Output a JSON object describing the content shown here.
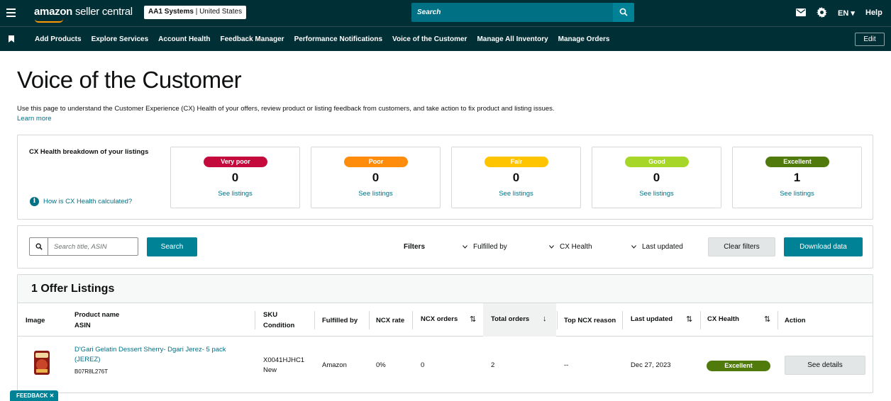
{
  "topbar": {
    "logo_text": "amazon",
    "logo_suffix": "seller central",
    "account_name": "AA1 Systems",
    "account_region": "United States",
    "search_placeholder": "Search",
    "language": "EN ▾",
    "help": "Help",
    "icons": [
      "hamburger-icon",
      "search-icon",
      "mail-icon",
      "gear-icon"
    ]
  },
  "nav": {
    "items": [
      {
        "label": "Add Products"
      },
      {
        "label": "Explore Services"
      },
      {
        "label": "Account Health"
      },
      {
        "label": "Feedback Manager"
      },
      {
        "label": "Performance Notifications"
      },
      {
        "label": "Voice of the Customer"
      },
      {
        "label": "Manage All Inventory"
      },
      {
        "label": "Manage Orders"
      }
    ],
    "edit_label": "Edit"
  },
  "header": {
    "title": "Voice of the Customer",
    "description": "Use this page to understand the Customer Experience (CX) Health of your offers, review product or listing feedback from customers, and take action to fix product and listing issues.",
    "learn_more": "Learn more"
  },
  "cx_health": {
    "title": "CX Health breakdown of your listings",
    "how_link": "How is CX Health calculated?",
    "cards": [
      {
        "label": "Very poor",
        "count": "0",
        "link": "See listings",
        "color": "#c40a3c"
      },
      {
        "label": "Poor",
        "count": "0",
        "link": "See listings",
        "color": "#ff8c0a"
      },
      {
        "label": "Fair",
        "count": "0",
        "link": "See listings",
        "color": "#ffc400"
      },
      {
        "label": "Good",
        "count": "0",
        "link": "See listings",
        "color": "#a5d628"
      },
      {
        "label": "Excellent",
        "count": "1",
        "link": "See listings",
        "color": "#507a0b"
      }
    ]
  },
  "filters": {
    "search_placeholder": "Search title, ASIN",
    "search_button": "Search",
    "label": "Filters",
    "dropdowns": [
      "Fulfilled by",
      "CX Health",
      "Last updated"
    ],
    "clear_button": "Clear filters",
    "download_button": "Download data"
  },
  "listings": {
    "title": "1 Offer Listings",
    "columns": {
      "image": "Image",
      "product_name": "Product name",
      "asin": "ASIN",
      "sku": "SKU",
      "condition": "Condition",
      "fulfilled_by": "Fulfilled by",
      "ncx_rate": "NCX rate",
      "ncx_orders": "NCX orders",
      "total_orders": "Total orders",
      "top_ncx_reason": "Top NCX reason",
      "last_updated": "Last updated",
      "cx_health": "CX Health",
      "action": "Action"
    },
    "rows": [
      {
        "product_name": "D'Gari Gelatin Dessert Sherry- Dgari Jerez- 5 pack (JEREZ)",
        "asin": "B07R8L276T",
        "sku": "X0041HJHC1",
        "condition": "New",
        "fulfilled_by": "Amazon",
        "ncx_rate": "0%",
        "ncx_orders": "0",
        "total_orders": "2",
        "top_ncx_reason": "--",
        "last_updated": "Dec 27, 2023",
        "cx_health": "Excellent",
        "action": "See details"
      }
    ]
  },
  "feedback_tab": "FEEDBACK ✕"
}
